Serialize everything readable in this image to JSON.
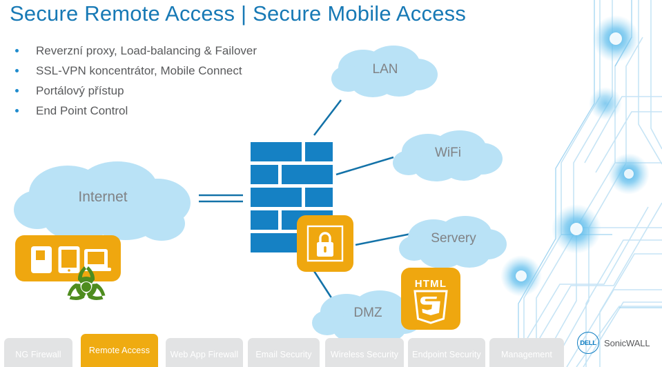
{
  "slide": {
    "title": "Secure Remote Access | Secure Mobile Access",
    "title_color": "#1779b5",
    "background": "#ffffff"
  },
  "bullets": [
    {
      "text": "Reverzní proxy, Load-balancing & Failover"
    },
    {
      "text": "SSL-VPN koncentrátor, Mobile Connect"
    },
    {
      "text": "Portálový přístup"
    },
    {
      "text": "End Point Control"
    }
  ],
  "diagram": {
    "clouds": [
      {
        "label": "LAN",
        "name": "cloud-lan"
      },
      {
        "label": "WiFi",
        "name": "cloud-wifi"
      },
      {
        "label": "Internet",
        "name": "cloud-internet"
      },
      {
        "label": "Servery",
        "name": "cloud-servery"
      },
      {
        "label": "DMZ",
        "name": "cloud-dmz"
      }
    ],
    "icons": {
      "firewall_wall": "brick-wall-icon",
      "lock": "padlock-icon",
      "devices": "mobile-devices-icon",
      "biohazard": "biohazard-icon",
      "html5": "html5-icon"
    },
    "html5_badge": {
      "wordmark": "HTML",
      "digit": "5"
    },
    "colors": {
      "cloud_fill": "#b9e2f6",
      "brick_blue": "#1581c4",
      "accent_orange": "#efa70f",
      "biohazard_green": "#4e8c1f",
      "label_gray": "#808285",
      "connector_blue": "#1372a8"
    }
  },
  "tabbar": {
    "tabs": [
      {
        "label": "NG Firewall",
        "active": false
      },
      {
        "label": "Remote Access",
        "active": true
      },
      {
        "label": "Web App Firewall",
        "active": false
      },
      {
        "label": "Email Security",
        "active": false
      },
      {
        "label": "Wireless Security",
        "active": false
      },
      {
        "label": "Endpoint Security",
        "active": false
      },
      {
        "label": "Management",
        "active": false
      }
    ],
    "inactive_color": "#e2e3e4",
    "active_color": "#efab11"
  },
  "logo": {
    "mark": "DELL",
    "wordmark": "SonicWALL",
    "color": "#0d7cc1"
  }
}
